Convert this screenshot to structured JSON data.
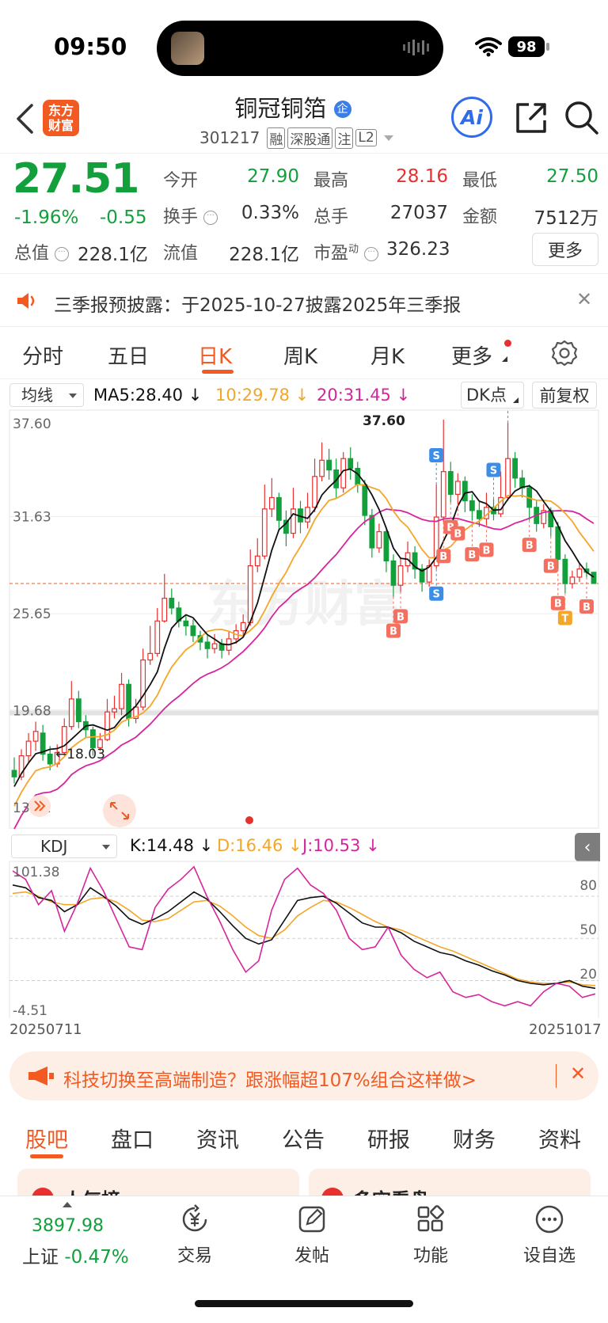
{
  "status_bar": {
    "time": "09:50",
    "battery": "98"
  },
  "header": {
    "logo_line1": "东方",
    "logo_line2": "财富",
    "stock_name": "铜冠铜箔",
    "stock_code": "301217",
    "tags": [
      "融",
      "深股通",
      "注",
      "L2"
    ],
    "ai_label": "Ai"
  },
  "quote": {
    "price": "27.51",
    "change_pct": "-1.96%",
    "change": "-0.55",
    "open_label": "今开",
    "open": "27.90",
    "high_label": "最高",
    "high": "28.16",
    "low_label": "最低",
    "low": "27.50",
    "turnover_label": "换手",
    "turnover": "0.33%",
    "volume_label": "总手",
    "volume": "27037",
    "amount_label": "金额",
    "amount": "7512万",
    "mktcap_label": "总值",
    "mktcap": "228.1亿",
    "float_label": "流值",
    "float": "228.1亿",
    "pe_label": "市盈",
    "pe_sup": "动",
    "pe": "326.23",
    "more_button": "更多"
  },
  "notice": {
    "text": "三季报预披露：于2025-10-27披露2025年三季报"
  },
  "chart_tabs": [
    "分时",
    "五日",
    "日K",
    "周K",
    "月K",
    "更多"
  ],
  "active_tab": "日K",
  "ma_bar": {
    "selector": "均线",
    "ma5": "MA5:28.40",
    "ma10": "10:29.78",
    "ma20": "20:31.45",
    "dk_button": "DK点",
    "adjust_button": "前复权"
  },
  "kdj_bar": {
    "selector": "KDJ",
    "k": "K:14.48",
    "d": "D:16.46",
    "j": "J:10.53"
  },
  "chart_data": [
    {
      "type": "candlestick",
      "y_tick_labels": [
        "37.60",
        "31.63",
        "25.65",
        "19.68",
        "13.71"
      ],
      "ylim": [
        13.71,
        37.6
      ],
      "annotations": [
        "37.60",
        "←18.03"
      ],
      "watermark": "东方财富",
      "series": [
        {
          "name": "MA5",
          "value": 28.4,
          "color": "#111111"
        },
        {
          "name": "10",
          "value": 29.78,
          "color": "#f4a62a"
        },
        {
          "name": "20",
          "value": 31.45,
          "color": "#d6259c"
        }
      ],
      "candles": [
        [
          16.0,
          15.6,
          16.8,
          15.2
        ],
        [
          15.6,
          16.9,
          17.3,
          15.4
        ],
        [
          16.9,
          17.8,
          18.3,
          16.5
        ],
        [
          17.8,
          18.4,
          19.0,
          17.2
        ],
        [
          18.3,
          17.0,
          18.8,
          16.6
        ],
        [
          17.0,
          16.4,
          17.5,
          16.0
        ],
        [
          16.4,
          17.1,
          17.6,
          16.2
        ],
        [
          17.1,
          18.7,
          19.2,
          16.9
        ],
        [
          18.7,
          20.4,
          21.5,
          18.5
        ],
        [
          20.4,
          19.0,
          20.9,
          18.6
        ],
        [
          19.0,
          18.5,
          19.4,
          18.0
        ],
        [
          18.5,
          17.4,
          18.7,
          16.9
        ],
        [
          17.4,
          17.9,
          18.3,
          17.2
        ],
        [
          17.9,
          19.6,
          20.4,
          17.8
        ],
        [
          19.6,
          19.8,
          20.6,
          19.2
        ],
        [
          19.8,
          21.3,
          22.0,
          19.4
        ],
        [
          21.3,
          19.2,
          21.6,
          18.7
        ],
        [
          19.2,
          19.9,
          20.4,
          18.9
        ],
        [
          19.9,
          22.8,
          23.5,
          19.7
        ],
        [
          22.8,
          23.2,
          24.9,
          22.5
        ],
        [
          23.2,
          25.2,
          26.0,
          23.0
        ],
        [
          25.2,
          26.6,
          28.1,
          25.1
        ],
        [
          26.6,
          26.0,
          27.2,
          25.6
        ],
        [
          26.0,
          25.2,
          26.4,
          24.8
        ],
        [
          25.2,
          24.9,
          25.5,
          24.3
        ],
        [
          24.9,
          24.3,
          25.3,
          23.9
        ],
        [
          24.3,
          23.9,
          24.6,
          23.4
        ],
        [
          23.9,
          23.5,
          24.3,
          22.9
        ],
        [
          23.5,
          23.8,
          24.4,
          23.2
        ],
        [
          23.8,
          23.4,
          24.1,
          22.9
        ],
        [
          23.4,
          24.1,
          24.6,
          23.1
        ],
        [
          24.1,
          24.6,
          25.0,
          23.8
        ],
        [
          24.6,
          25.1,
          25.6,
          24.3
        ],
        [
          25.1,
          28.6,
          29.6,
          24.9
        ],
        [
          28.6,
          29.2,
          30.3,
          28.2
        ],
        [
          29.2,
          32.1,
          33.6,
          29.0
        ],
        [
          32.1,
          32.8,
          34.0,
          31.6
        ],
        [
          32.8,
          31.4,
          33.1,
          30.8
        ],
        [
          31.4,
          30.6,
          32.0,
          29.8
        ],
        [
          30.6,
          32.1,
          33.4,
          30.3
        ],
        [
          32.1,
          31.3,
          32.6,
          30.6
        ],
        [
          31.3,
          32.2,
          33.1,
          30.9
        ],
        [
          32.2,
          34.1,
          35.2,
          31.9
        ],
        [
          34.1,
          35.1,
          36.2,
          33.8
        ],
        [
          35.1,
          34.5,
          35.8,
          33.9
        ],
        [
          34.5,
          33.4,
          35.2,
          32.8
        ],
        [
          33.4,
          35.2,
          35.6,
          33.1
        ],
        [
          35.2,
          34.6,
          35.9,
          33.9
        ],
        [
          34.6,
          33.6,
          35.0,
          33.1
        ],
        [
          33.6,
          31.7,
          33.9,
          31.1
        ],
        [
          31.7,
          29.7,
          32.1,
          29.1
        ],
        [
          29.7,
          30.7,
          31.2,
          29.4
        ],
        [
          30.7,
          28.9,
          31.0,
          28.2
        ],
        [
          28.9,
          27.4,
          29.3,
          26.7
        ],
        [
          27.4,
          28.6,
          29.1,
          27.0
        ],
        [
          28.6,
          29.4,
          30.1,
          28.2
        ],
        [
          29.4,
          28.4,
          29.8,
          27.8
        ],
        [
          28.4,
          27.6,
          28.7,
          27.0
        ],
        [
          27.6,
          28.6,
          29.0,
          27.3
        ],
        [
          28.6,
          31.6,
          33.6,
          28.4
        ],
        [
          31.6,
          34.4,
          37.6,
          31.3
        ],
        [
          34.4,
          33.0,
          35.0,
          32.5
        ],
        [
          33.0,
          33.8,
          34.3,
          32.4
        ],
        [
          33.8,
          32.6,
          34.1,
          31.9
        ],
        [
          32.6,
          32.0,
          33.0,
          31.4
        ],
        [
          32.0,
          31.5,
          32.6,
          31.0
        ],
        [
          31.5,
          32.2,
          33.1,
          31.1
        ],
        [
          32.2,
          31.8,
          32.7,
          31.4
        ],
        [
          31.8,
          32.8,
          34.4,
          31.6
        ],
        [
          32.8,
          35.2,
          37.4,
          32.6
        ],
        [
          35.2,
          34.0,
          35.6,
          33.4
        ],
        [
          34.0,
          33.4,
          34.5,
          32.8
        ],
        [
          33.4,
          32.2,
          33.6,
          31.4
        ],
        [
          32.2,
          31.2,
          32.6,
          30.7
        ],
        [
          31.2,
          32.0,
          32.4,
          30.9
        ],
        [
          32.0,
          31.0,
          32.2,
          30.4
        ],
        [
          31.0,
          29.0,
          31.3,
          28.4
        ],
        [
          29.0,
          27.5,
          29.3,
          26.9
        ],
        [
          27.5,
          27.9,
          28.3,
          27.2
        ],
        [
          27.9,
          28.4,
          28.7,
          27.6
        ],
        [
          28.4,
          28.2,
          28.8,
          27.9
        ],
        [
          28.2,
          27.51,
          28.16,
          27.5
        ]
      ]
    },
    {
      "type": "line",
      "title": "KDJ",
      "y_tick_labels": [
        "101.38",
        "-4.51"
      ],
      "ylim": [
        -4.51,
        101.38
      ],
      "right_tick_labels": [
        "80",
        "50",
        "20"
      ],
      "x_labels": [
        "20250711",
        "20251017"
      ],
      "series": [
        {
          "name": "K",
          "value": 14.48,
          "color": "#111111",
          "values": [
            88,
            86,
            79,
            77,
            69,
            74,
            86,
            80,
            73,
            64,
            60,
            64,
            69,
            76,
            83,
            78,
            69,
            59,
            50,
            46,
            49,
            63,
            77,
            79,
            80,
            75,
            68,
            61,
            58,
            58,
            54,
            48,
            44,
            40,
            38,
            34,
            31,
            27,
            24,
            20,
            18,
            17,
            18,
            20,
            16,
            14.48
          ]
        },
        {
          "name": "D",
          "value": 16.46,
          "color": "#f4a62a",
          "values": [
            82,
            83,
            80,
            76,
            74,
            74,
            78,
            79,
            76,
            70,
            63,
            62,
            64,
            70,
            76,
            77,
            73,
            66,
            58,
            52,
            50,
            56,
            66,
            72,
            77,
            76,
            72,
            67,
            62,
            58,
            56,
            52,
            48,
            44,
            41,
            37,
            33,
            29,
            25,
            21,
            19,
            18,
            18,
            19,
            17,
            16.46
          ]
        },
        {
          "name": "J",
          "value": 10.53,
          "color": "#d6259c",
          "values": [
            98,
            92,
            74,
            84,
            55,
            75,
            100,
            84,
            64,
            44,
            42,
            72,
            85,
            92,
            101,
            80,
            62,
            42,
            26,
            34,
            70,
            92,
            100,
            88,
            82,
            70,
            50,
            42,
            44,
            58,
            38,
            28,
            22,
            26,
            12,
            8,
            10,
            5,
            2,
            5,
            2,
            12,
            18,
            16,
            8,
            10.53
          ]
        }
      ]
    }
  ],
  "promo": {
    "text": "科技切换至高端制造？跟涨幅超107%组合这样做>"
  },
  "bottom_tabs": [
    "股吧",
    "盘口",
    "资讯",
    "公告",
    "研报",
    "财务",
    "资料"
  ],
  "active_bottom_tab": "股吧",
  "peek_items": [
    "人气榜",
    "多空看盘"
  ],
  "nav": {
    "index_value": "3897.98",
    "index_name": "上证",
    "index_change": "-0.47%",
    "items": [
      {
        "label": "交易",
        "icon": "yen-exchange-icon"
      },
      {
        "label": "发帖",
        "icon": "compose-icon"
      },
      {
        "label": "功能",
        "icon": "grid-icon"
      },
      {
        "label": "设自选",
        "icon": "more-dots-icon"
      }
    ]
  },
  "colors": {
    "up": "#e8302e",
    "down": "#13a03c",
    "accent": "#f25a22",
    "ma5": "#111111",
    "ma10": "#f4a62a",
    "ma20": "#d6259c"
  }
}
